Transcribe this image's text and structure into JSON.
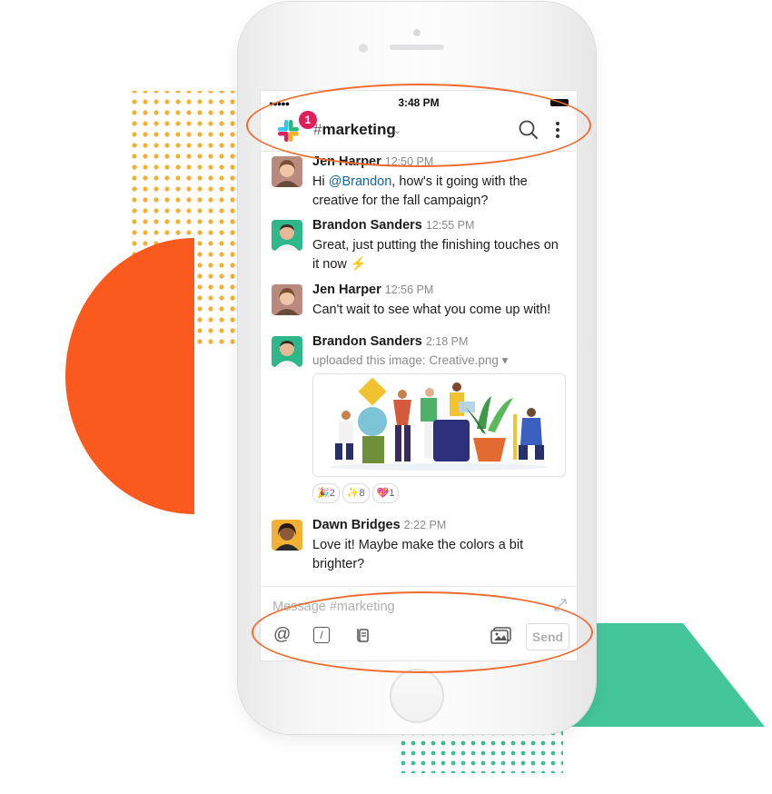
{
  "status_bar": {
    "time": "3:48 PM",
    "signal": "●●●●●"
  },
  "header": {
    "badge_count": "1",
    "channel_hash": "#",
    "channel_name": "marketing",
    "caret": "⌄"
  },
  "messages": [
    {
      "author": "Jen Harper",
      "time": "12:50 PM",
      "text_before": "Hi ",
      "mention": "@Brandon",
      "text_after": ", how's it going with the creative for the fall campaign?"
    },
    {
      "author": "Brandon Sanders",
      "time": "12:55 PM",
      "text": "Great, just putting the finishing touches on it now",
      "emoji": "⚡"
    },
    {
      "author": "Jen Harper",
      "time": "12:56 PM",
      "text": "Can't wait to see what you come up with!"
    },
    {
      "author": "Brandon Sanders",
      "time": "2:18 PM",
      "upload_text": "uploaded this image: Creative.png",
      "upload_caret": "▾",
      "reactions": [
        {
          "emoji": "🎉",
          "count": "2"
        },
        {
          "emoji": "✨",
          "count": "8"
        },
        {
          "emoji": "💖",
          "count": "1"
        }
      ]
    },
    {
      "author": "Dawn Bridges",
      "time": "2:22 PM",
      "text": "Love it! Maybe make the colors a bit brighter?"
    }
  ],
  "composer": {
    "placeholder": "Message #marketing",
    "send_label": "Send",
    "at_symbol": "@",
    "slash_symbol": "/"
  },
  "colors": {
    "accent_orange": "#f26a2e",
    "slack_red": "#e01e5a",
    "mention_blue": "#1264a3",
    "deco_green": "#3cbf92",
    "deco_yellow": "#f2b134"
  }
}
